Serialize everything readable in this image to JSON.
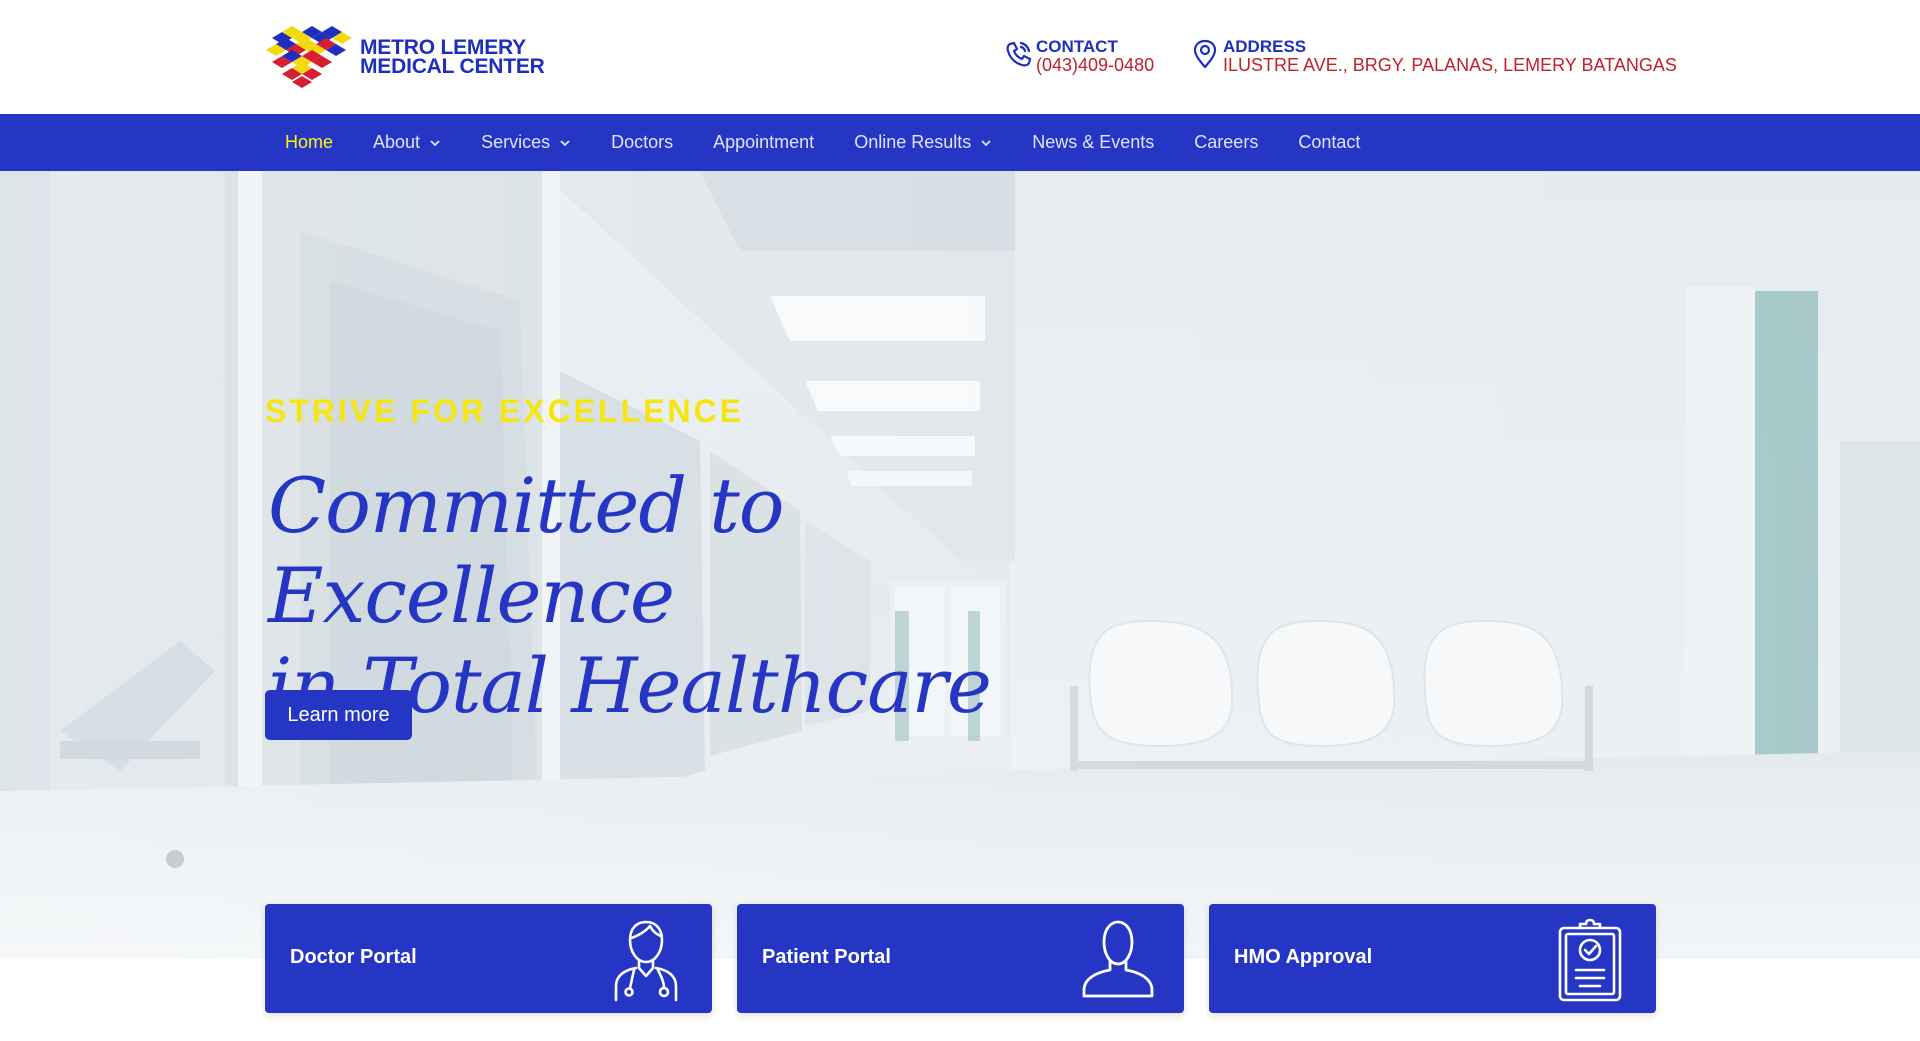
{
  "header": {
    "logo": {
      "line1": "METRO LEMERY",
      "line2": "MEDICAL CENTER",
      "icon": "diamond-tiles-logo"
    },
    "contact": {
      "label": "CONTACT",
      "value": "(043)409-0480",
      "icon": "phone-icon"
    },
    "address": {
      "label": "ADDRESS",
      "value": "ILUSTRE AVE., BRGY. PALANAS, LEMERY BATANGAS",
      "icon": "map-pin-icon"
    }
  },
  "nav": {
    "items": [
      {
        "label": "Home",
        "active": true,
        "dropdown": false
      },
      {
        "label": "About",
        "active": false,
        "dropdown": true
      },
      {
        "label": "Services",
        "active": false,
        "dropdown": true
      },
      {
        "label": "Doctors",
        "active": false,
        "dropdown": false
      },
      {
        "label": "Appointment",
        "active": false,
        "dropdown": false
      },
      {
        "label": "Online Results",
        "active": false,
        "dropdown": true
      },
      {
        "label": "News & Events",
        "active": false,
        "dropdown": false
      },
      {
        "label": "Careers",
        "active": false,
        "dropdown": false
      },
      {
        "label": "Contact",
        "active": false,
        "dropdown": false
      }
    ]
  },
  "hero": {
    "eyebrow": "STRIVE FOR EXCELLENCE",
    "headline_line1": "Committed to Excellence",
    "headline_line2": "in Total Healthcare",
    "cta_label": "Learn more"
  },
  "portals": [
    {
      "label": "Doctor Portal",
      "icon": "doctor-icon"
    },
    {
      "label": "Patient Portal",
      "icon": "user-icon"
    },
    {
      "label": "HMO Approval",
      "icon": "clipboard-check-icon"
    }
  ],
  "colors": {
    "brand_blue": "#2536c4",
    "accent_yellow": "#f5e60f",
    "address_red": "#c0212b",
    "logo_red": "#d42030",
    "logo_yellow": "#f5d90f",
    "logo_blue": "#1e2fbf"
  }
}
